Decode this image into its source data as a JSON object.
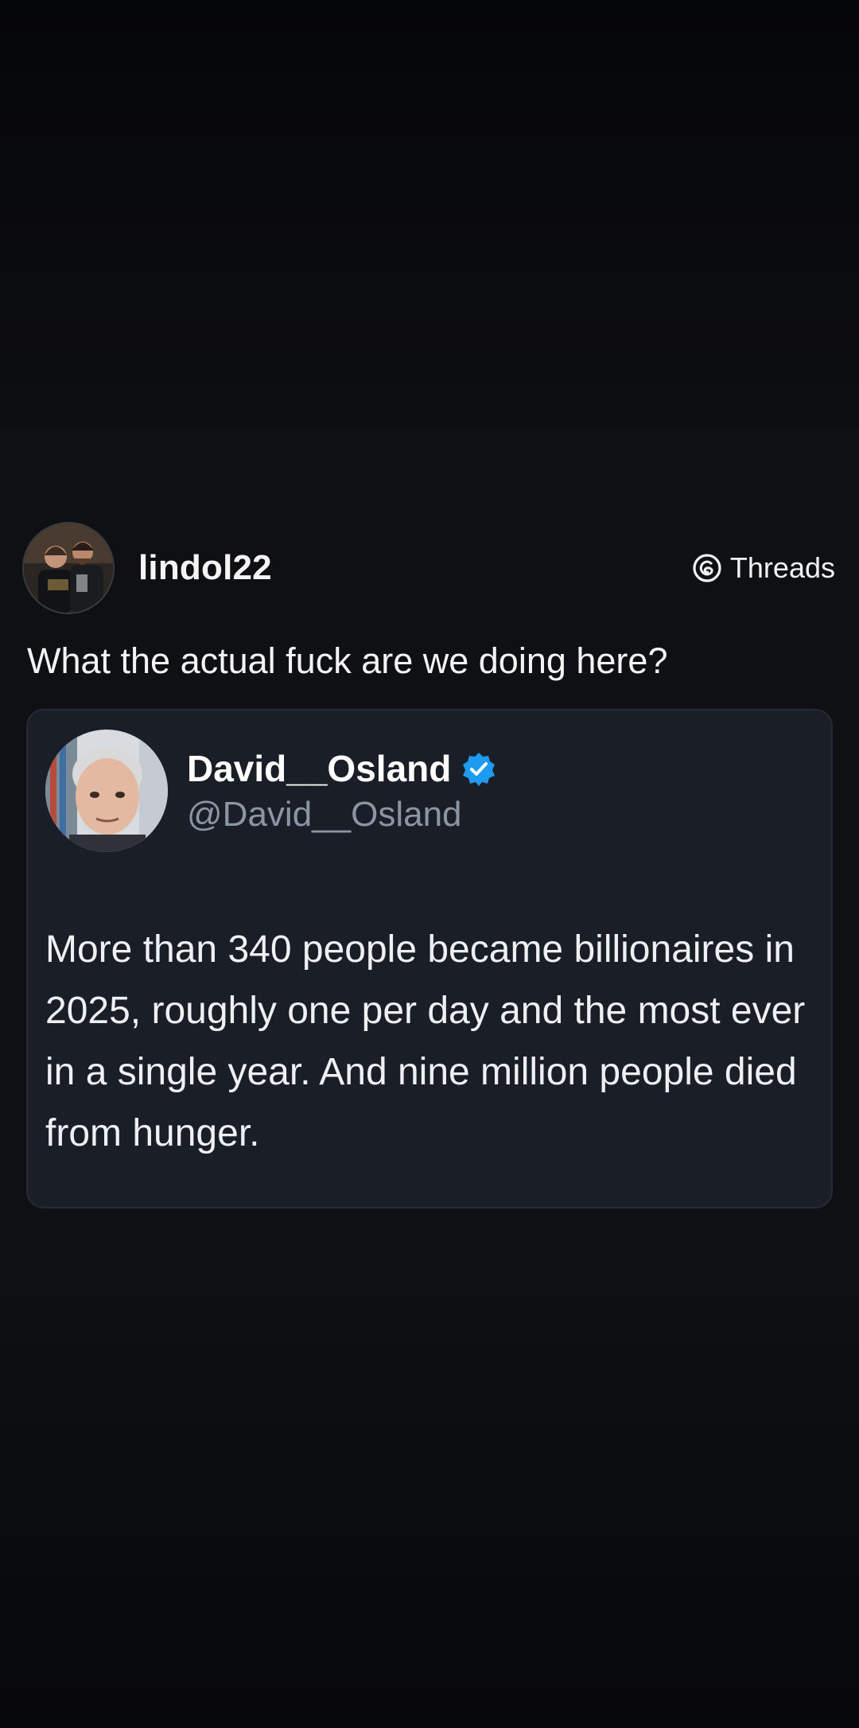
{
  "app": {
    "name": "Threads"
  },
  "post": {
    "username": "lindol22",
    "text": "What the actual fuck are we doing here?",
    "avatar_icon": "profile-photo-two-people",
    "quoted": {
      "display_name": "David__Osland",
      "handle": "@David__Osland",
      "verified": true,
      "verified_color": "#1d9bf0",
      "avatar_icon": "profile-photo-man",
      "text": "More than 340 people became billionaires in 2025, roughly one per day and the most ever in a single year. And nine million people died from hunger."
    }
  },
  "icons": {
    "threads_logo": "threads-logo-icon",
    "verified_badge": "verified-badge-icon"
  }
}
